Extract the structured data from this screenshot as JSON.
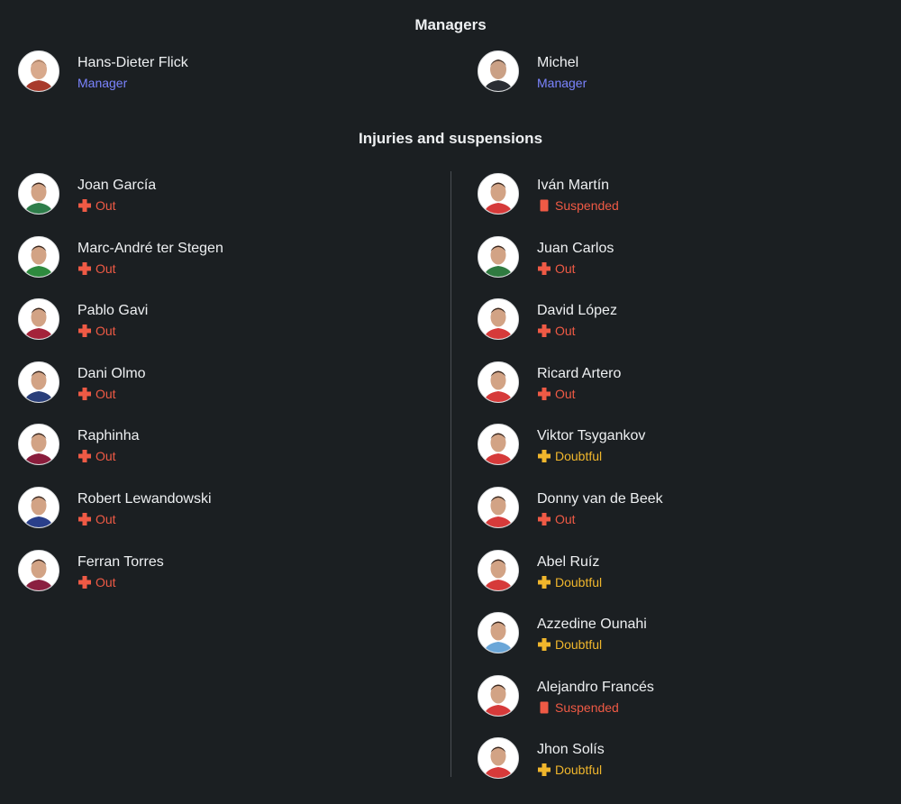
{
  "managers": {
    "title": "Managers",
    "left": {
      "name": "Hans-Dieter Flick",
      "role": "Manager"
    },
    "right": {
      "name": "Michel",
      "role": "Manager"
    }
  },
  "injuries": {
    "title": "Injuries and suspensions",
    "left": [
      {
        "name": "Joan García",
        "status": "Out",
        "type": "out",
        "shirt": "#2e7d4a"
      },
      {
        "name": "Marc-André ter Stegen",
        "status": "Out",
        "type": "out",
        "shirt": "#2e8a3e"
      },
      {
        "name": "Pablo Gavi",
        "status": "Out",
        "type": "out",
        "shirt": "#a4233a"
      },
      {
        "name": "Dani Olmo",
        "status": "Out",
        "type": "out",
        "shirt": "#2a3f7a"
      },
      {
        "name": "Raphinha",
        "status": "Out",
        "type": "out",
        "shirt": "#8a1d3c"
      },
      {
        "name": "Robert Lewandowski",
        "status": "Out",
        "type": "out",
        "shirt": "#2a3f8a"
      },
      {
        "name": "Ferran Torres",
        "status": "Out",
        "type": "out",
        "shirt": "#8a2040"
      }
    ],
    "right": [
      {
        "name": "Iván Martín",
        "status": "Suspended",
        "type": "suspended",
        "shirt": "#d63a3a"
      },
      {
        "name": "Juan Carlos",
        "status": "Out",
        "type": "out",
        "shirt": "#2f7a40"
      },
      {
        "name": "David López",
        "status": "Out",
        "type": "out",
        "shirt": "#d63a3a"
      },
      {
        "name": "Ricard Artero",
        "status": "Out",
        "type": "out",
        "shirt": "#d63a3a"
      },
      {
        "name": "Viktor Tsygankov",
        "status": "Doubtful",
        "type": "doubtful",
        "shirt": "#d63a3a"
      },
      {
        "name": "Donny van de Beek",
        "status": "Out",
        "type": "out",
        "shirt": "#d63a3a"
      },
      {
        "name": "Abel Ruíz",
        "status": "Doubtful",
        "type": "doubtful",
        "shirt": "#d63a3a"
      },
      {
        "name": "Azzedine Ounahi",
        "status": "Doubtful",
        "type": "doubtful",
        "shirt": "#6aa6d8"
      },
      {
        "name": "Alejandro Francés",
        "status": "Suspended",
        "type": "suspended",
        "shirt": "#d63a3a"
      },
      {
        "name": "Jhon Solís",
        "status": "Doubtful",
        "type": "doubtful",
        "shirt": "#d63a3a"
      }
    ]
  },
  "colors": {
    "background": "#1b1f22",
    "role": "#7b84ff",
    "out": "#ef5a45",
    "suspended": "#ef5a45",
    "doubtful": "#f0b62c"
  }
}
